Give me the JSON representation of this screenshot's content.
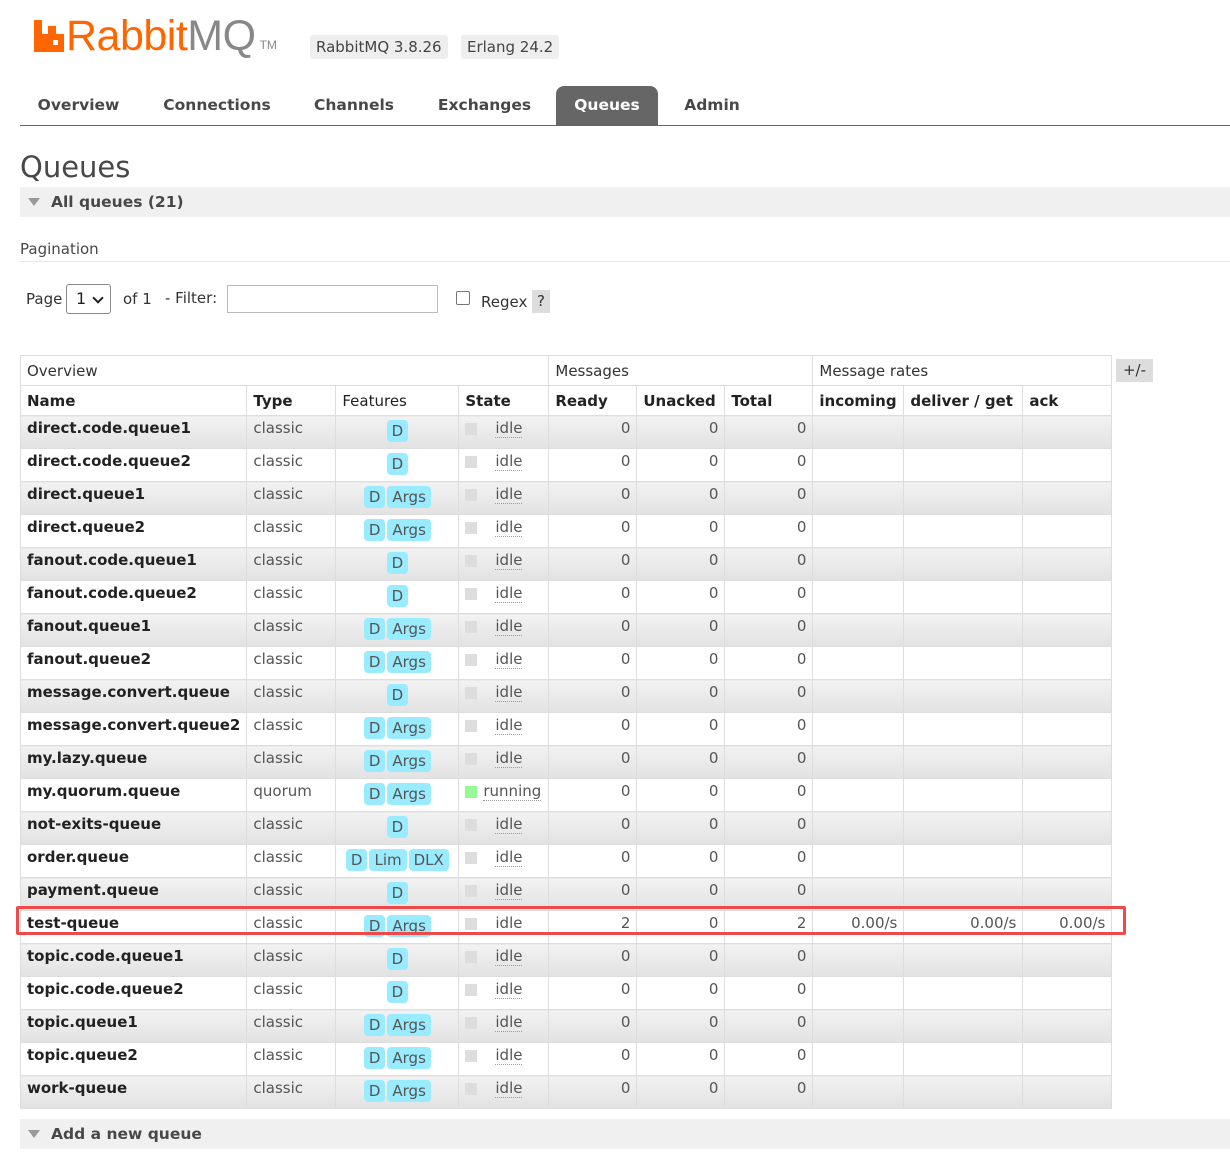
{
  "header": {
    "logo_rabbit": "Rabbit",
    "logo_mq": "MQ",
    "logo_tm": "TM",
    "version_rabbitmq": "RabbitMQ 3.8.26",
    "version_erlang": "Erlang 24.2"
  },
  "tabs": [
    {
      "label": "Overview",
      "active": false
    },
    {
      "label": "Connections",
      "active": false
    },
    {
      "label": "Channels",
      "active": false
    },
    {
      "label": "Exchanges",
      "active": false
    },
    {
      "label": "Queues",
      "active": true
    },
    {
      "label": "Admin",
      "active": false
    }
  ],
  "page_title": "Queues",
  "all_queues_label": "All queues (21)",
  "pagination": {
    "section_label": "Pagination",
    "page_label": "Page",
    "page_value": "1",
    "of_label": "of 1",
    "filter_label": "- Filter:",
    "filter_value": "",
    "regex_label": "Regex",
    "regex_checked": false,
    "help_label": "?"
  },
  "table": {
    "groups": [
      "Overview",
      "Messages",
      "Message rates"
    ],
    "columns": [
      "Name",
      "Type",
      "Features",
      "State",
      "Ready",
      "Unacked",
      "Total",
      "incoming",
      "deliver / get",
      "ack"
    ],
    "plus_minus": "+/-",
    "rows": [
      {
        "name": "direct.code.queue1",
        "type": "classic",
        "features": [
          "D"
        ],
        "state": "idle",
        "ready": "0",
        "unacked": "0",
        "total": "0",
        "incoming": "",
        "deliver": "",
        "ack": ""
      },
      {
        "name": "direct.code.queue2",
        "type": "classic",
        "features": [
          "D"
        ],
        "state": "idle",
        "ready": "0",
        "unacked": "0",
        "total": "0",
        "incoming": "",
        "deliver": "",
        "ack": ""
      },
      {
        "name": "direct.queue1",
        "type": "classic",
        "features": [
          "D",
          "Args"
        ],
        "state": "idle",
        "ready": "0",
        "unacked": "0",
        "total": "0",
        "incoming": "",
        "deliver": "",
        "ack": ""
      },
      {
        "name": "direct.queue2",
        "type": "classic",
        "features": [
          "D",
          "Args"
        ],
        "state": "idle",
        "ready": "0",
        "unacked": "0",
        "total": "0",
        "incoming": "",
        "deliver": "",
        "ack": ""
      },
      {
        "name": "fanout.code.queue1",
        "type": "classic",
        "features": [
          "D"
        ],
        "state": "idle",
        "ready": "0",
        "unacked": "0",
        "total": "0",
        "incoming": "",
        "deliver": "",
        "ack": ""
      },
      {
        "name": "fanout.code.queue2",
        "type": "classic",
        "features": [
          "D"
        ],
        "state": "idle",
        "ready": "0",
        "unacked": "0",
        "total": "0",
        "incoming": "",
        "deliver": "",
        "ack": ""
      },
      {
        "name": "fanout.queue1",
        "type": "classic",
        "features": [
          "D",
          "Args"
        ],
        "state": "idle",
        "ready": "0",
        "unacked": "0",
        "total": "0",
        "incoming": "",
        "deliver": "",
        "ack": ""
      },
      {
        "name": "fanout.queue2",
        "type": "classic",
        "features": [
          "D",
          "Args"
        ],
        "state": "idle",
        "ready": "0",
        "unacked": "0",
        "total": "0",
        "incoming": "",
        "deliver": "",
        "ack": ""
      },
      {
        "name": "message.convert.queue",
        "type": "classic",
        "features": [
          "D"
        ],
        "state": "idle",
        "ready": "0",
        "unacked": "0",
        "total": "0",
        "incoming": "",
        "deliver": "",
        "ack": ""
      },
      {
        "name": "message.convert.queue2",
        "type": "classic",
        "features": [
          "D",
          "Args"
        ],
        "state": "idle",
        "ready": "0",
        "unacked": "0",
        "total": "0",
        "incoming": "",
        "deliver": "",
        "ack": ""
      },
      {
        "name": "my.lazy.queue",
        "type": "classic",
        "features": [
          "D",
          "Args"
        ],
        "state": "idle",
        "ready": "0",
        "unacked": "0",
        "total": "0",
        "incoming": "",
        "deliver": "",
        "ack": ""
      },
      {
        "name": "my.quorum.queue",
        "type": "quorum",
        "features": [
          "D",
          "Args"
        ],
        "state": "running",
        "ready": "0",
        "unacked": "0",
        "total": "0",
        "incoming": "",
        "deliver": "",
        "ack": ""
      },
      {
        "name": "not-exits-queue",
        "type": "classic",
        "features": [
          "D"
        ],
        "state": "idle",
        "ready": "0",
        "unacked": "0",
        "total": "0",
        "incoming": "",
        "deliver": "",
        "ack": ""
      },
      {
        "name": "order.queue",
        "type": "classic",
        "features": [
          "D",
          "Lim",
          "DLX"
        ],
        "state": "idle",
        "ready": "0",
        "unacked": "0",
        "total": "0",
        "incoming": "",
        "deliver": "",
        "ack": ""
      },
      {
        "name": "payment.queue",
        "type": "classic",
        "features": [
          "D"
        ],
        "state": "idle",
        "ready": "0",
        "unacked": "0",
        "total": "0",
        "incoming": "",
        "deliver": "",
        "ack": ""
      },
      {
        "name": "test-queue",
        "type": "classic",
        "features": [
          "D",
          "Args"
        ],
        "state": "idle",
        "ready": "2",
        "unacked": "0",
        "total": "2",
        "incoming": "0.00/s",
        "deliver": "0.00/s",
        "ack": "0.00/s"
      },
      {
        "name": "topic.code.queue1",
        "type": "classic",
        "features": [
          "D"
        ],
        "state": "idle",
        "ready": "0",
        "unacked": "0",
        "total": "0",
        "incoming": "",
        "deliver": "",
        "ack": ""
      },
      {
        "name": "topic.code.queue2",
        "type": "classic",
        "features": [
          "D"
        ],
        "state": "idle",
        "ready": "0",
        "unacked": "0",
        "total": "0",
        "incoming": "",
        "deliver": "",
        "ack": ""
      },
      {
        "name": "topic.queue1",
        "type": "classic",
        "features": [
          "D",
          "Args"
        ],
        "state": "idle",
        "ready": "0",
        "unacked": "0",
        "total": "0",
        "incoming": "",
        "deliver": "",
        "ack": ""
      },
      {
        "name": "topic.queue2",
        "type": "classic",
        "features": [
          "D",
          "Args"
        ],
        "state": "idle",
        "ready": "0",
        "unacked": "0",
        "total": "0",
        "incoming": "",
        "deliver": "",
        "ack": ""
      },
      {
        "name": "work-queue",
        "type": "classic",
        "features": [
          "D",
          "Args"
        ],
        "state": "idle",
        "ready": "0",
        "unacked": "0",
        "total": "0",
        "incoming": "",
        "deliver": "",
        "ack": ""
      }
    ]
  },
  "add_queue_label": "Add a new queue",
  "colors": {
    "brand_orange": "#ff6600",
    "active_tab": "#666666",
    "feature_badge": "#99ebff",
    "running_indicator": "#98f898",
    "highlight_box": "#ee4a4a"
  }
}
